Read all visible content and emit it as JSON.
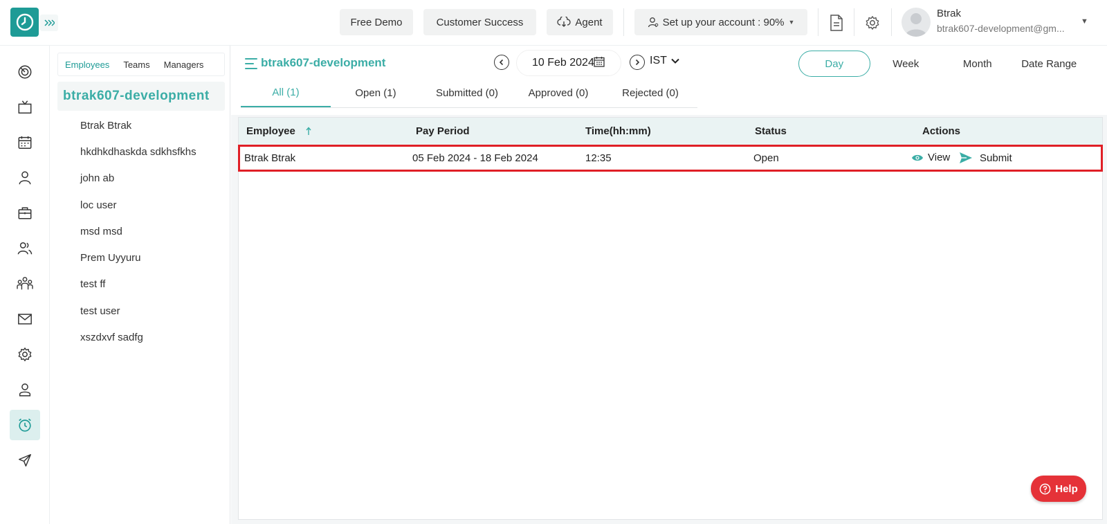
{
  "header": {
    "free_demo": "Free Demo",
    "customer_success": "Customer Success",
    "agent": "Agent",
    "setup_account": "Set up your account : 90%",
    "user_name": "Btrak",
    "user_email": "btrak607-development@gm..."
  },
  "rail": {
    "icons": [
      "dashboard-icon",
      "tv-icon",
      "calendar-icon",
      "user-icon",
      "briefcase-icon",
      "users-icon",
      "team-icon",
      "mail-icon",
      "settings-icon",
      "profile-icon",
      "timesheet-icon",
      "send-icon"
    ],
    "active_index": 10
  },
  "panel": {
    "tabs": [
      "Employees",
      "Teams",
      "Managers"
    ],
    "active_tab": "Employees",
    "team_name": "btrak607-development",
    "employees": [
      "Btrak Btrak",
      "hkdhkdhaskda sdkhsfkhs",
      "john ab",
      "loc user",
      "msd msd",
      "Prem Uyyuru",
      "test ff",
      "test user",
      "xszdxvf sadfg"
    ]
  },
  "main": {
    "team_title": "btrak607-development",
    "date": "10 Feb 2024",
    "timezone": "IST",
    "views": [
      "Day",
      "Week",
      "Month",
      "Date Range"
    ],
    "active_view": "Day",
    "filters": [
      "All (1)",
      "Open (1)",
      "Submitted (0)",
      "Approved (0)",
      "Rejected (0)"
    ],
    "active_filter": "All (1)"
  },
  "table": {
    "headers": [
      "Employee",
      "Pay Period",
      "Time(hh:mm)",
      "Status",
      "Actions"
    ],
    "rows": [
      {
        "employee": "Btrak Btrak",
        "pay_period": "05 Feb 2024 - 18 Feb 2024",
        "time": "12:35",
        "status": "Open",
        "view": "View",
        "submit": "Submit"
      }
    ]
  },
  "help": "Help",
  "colors": {
    "accent": "#3bada6",
    "brand": "#1e9b96",
    "highlight": "#e01f26",
    "help": "#e53238"
  }
}
